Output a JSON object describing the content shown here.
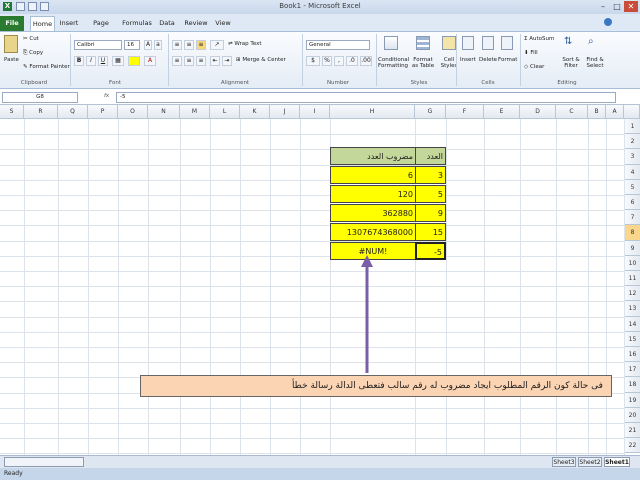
{
  "window": {
    "title": "Book1 - Microsoft Excel"
  },
  "tabs": [
    "File",
    "Home",
    "Insert",
    "Page Layout",
    "Formulas",
    "Data",
    "Review",
    "View"
  ],
  "ribbon": {
    "clipboard": {
      "paste": "Paste",
      "cut": "Cut",
      "copy": "Copy",
      "format_painter": "Format Painter",
      "label": "Clipboard"
    },
    "font": {
      "name": "Calibri",
      "size": "16",
      "label": "Font"
    },
    "alignment": {
      "wrap_text": "Wrap Text",
      "merge_center": "Merge & Center",
      "label": "Alignment"
    },
    "number": {
      "format": "General",
      "label": "Number"
    },
    "styles": {
      "conditional": "Conditional",
      "conditional2": "Formatting",
      "format_as": "Format",
      "format_as2": "as Table",
      "cell": "Cell",
      "cell2": "Styles",
      "label": "Styles"
    },
    "cells": {
      "insert": "Insert",
      "delete": "Delete",
      "format": "Format",
      "label": "Cells"
    },
    "editing": {
      "autosum": "AutoSum",
      "fill": "Fill",
      "clear": "Clear",
      "sort": "Sort &",
      "sort2": "Filter",
      "find": "Find &",
      "find2": "Select",
      "label": "Editing"
    }
  },
  "formula_bar": {
    "name_box": "G8",
    "fx": "fx",
    "formula": "-5"
  },
  "columns": [
    "S",
    "R",
    "Q",
    "P",
    "O",
    "N",
    "M",
    "L",
    "K",
    "J",
    "I",
    "H",
    "G",
    "F",
    "E",
    "D",
    "C",
    "B",
    "A"
  ],
  "rows": [
    "1",
    "2",
    "3",
    "4",
    "5",
    "6",
    "7",
    "8",
    "9",
    "10",
    "11",
    "12",
    "13",
    "14",
    "15",
    "16",
    "17",
    "18",
    "19",
    "20",
    "21",
    "22"
  ],
  "table": {
    "header_h": "مضروب العدد",
    "header_g": "العدد",
    "rows": [
      {
        "h": "6",
        "g": "3"
      },
      {
        "h": "120",
        "g": "5"
      },
      {
        "h": "362880",
        "g": "9"
      },
      {
        "h": "1307674368000",
        "g": "15"
      },
      {
        "h": "#NUM!",
        "g": "-5"
      }
    ]
  },
  "callout": "فى حالة كون الرقم المطلوب ايجاد مضروب له رقم سالب فتعطى الدالة رسالة خطأ",
  "sheets": [
    "Sheet3",
    "Sheet2",
    "Sheet1"
  ],
  "status": "Ready",
  "colors": {
    "highlight": "#ffff00",
    "header_fill": "#c4d79b",
    "callout_fill": "#fbd4b4",
    "arrow": "#7a5fa8"
  }
}
